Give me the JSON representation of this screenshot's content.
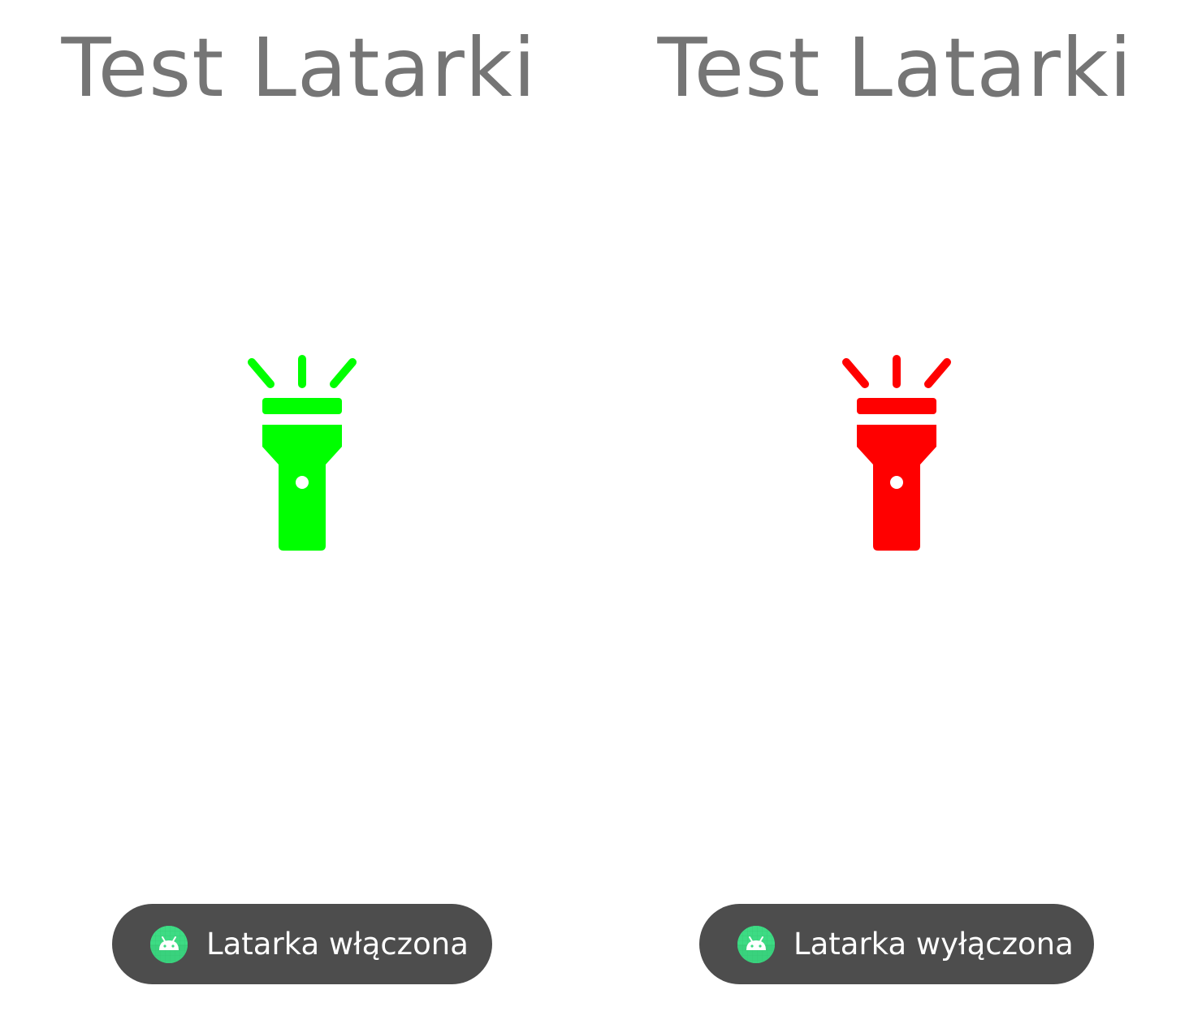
{
  "screens": [
    {
      "title": "Test Latarki",
      "icon": "flashlight-icon",
      "icon_color": "#00ff00",
      "toast": {
        "app_icon": "android-app-icon",
        "message": "Latarka włączona"
      }
    },
    {
      "title": "Test Latarki",
      "icon": "flashlight-icon",
      "icon_color": "#ff0000",
      "toast": {
        "app_icon": "android-app-icon",
        "message": "Latarka wyłączona"
      }
    }
  ],
  "colors": {
    "title_text": "#757575",
    "toast_background": "#4d4d4d",
    "toast_text": "#ffffff",
    "android_green": "#3ddc84"
  }
}
